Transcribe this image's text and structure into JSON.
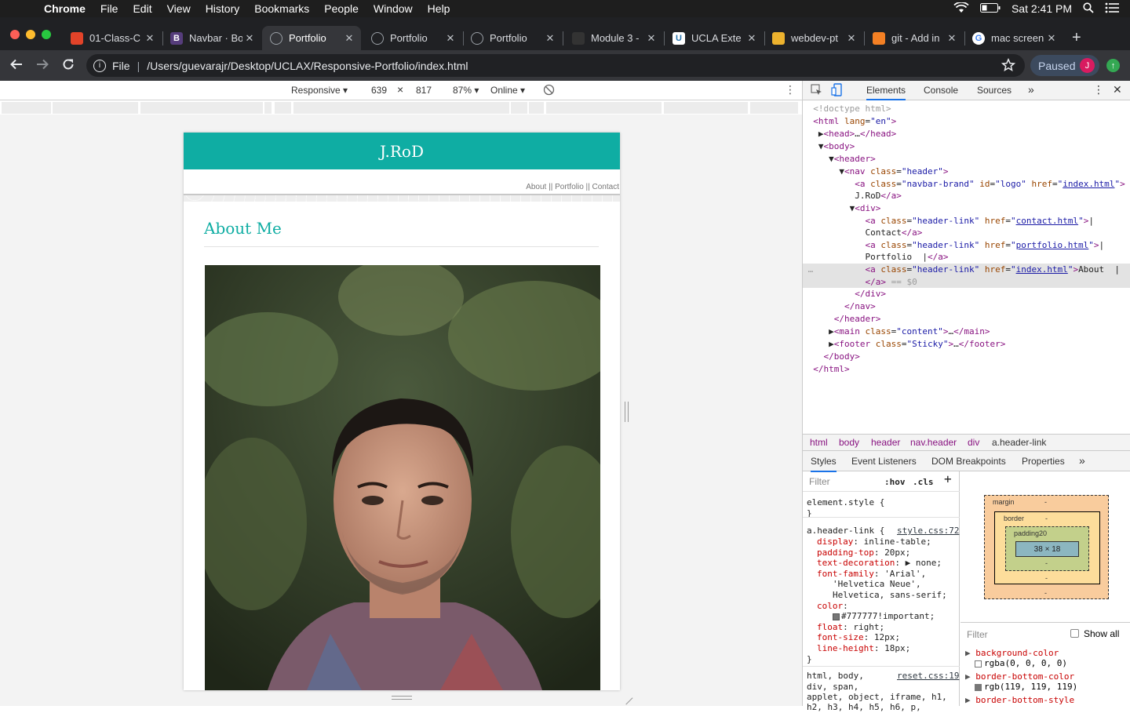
{
  "menubar": {
    "app": "Chrome",
    "items": [
      "File",
      "Edit",
      "View",
      "History",
      "Bookmarks",
      "People",
      "Window",
      "Help"
    ],
    "clock": "Sat 2:41 PM"
  },
  "tabs": [
    {
      "title": "01-Class-C",
      "icon": "gitlab-icon",
      "color": "#e24329"
    },
    {
      "title": "Navbar · Bo",
      "icon": "bootstrap-icon",
      "color": "#563d7c"
    },
    {
      "title": "Portfolio",
      "icon": "globe-icon",
      "color": "#5f6368"
    },
    {
      "title": "Portfolio",
      "icon": "globe-icon",
      "color": "#5f6368"
    },
    {
      "title": "Portfolio",
      "icon": "globe-icon",
      "color": "#5f6368"
    },
    {
      "title": "Module 3 -",
      "icon": "book-icon",
      "color": "#333333"
    },
    {
      "title": "UCLA Exte",
      "icon": "ucla-icon",
      "color": "#2774ae"
    },
    {
      "title": "webdev-pt",
      "icon": "slack-icon",
      "color": "#ecb22e"
    },
    {
      "title": "git - Add in",
      "icon": "stackoverflow-icon",
      "color": "#f48024"
    },
    {
      "title": "mac screen",
      "icon": "google-icon",
      "color": "#ffffff"
    }
  ],
  "active_tab": 2,
  "address": {
    "scheme": "File",
    "path": "/Users/guevarajr/Desktop/UCLAX/Responsive-Portfolio/index.html"
  },
  "profile": {
    "label": "Paused",
    "initial": "J"
  },
  "device": {
    "mode": "Responsive",
    "width": "639",
    "times": "×",
    "height": "817",
    "zoom": "87%",
    "network": "Online"
  },
  "site": {
    "brand": "J.RoD",
    "nav": "About || Portfolio || Contact",
    "heading": "About Me"
  },
  "devtools": {
    "tabs": [
      "Elements",
      "Console",
      "Sources"
    ],
    "breadcrumbs": [
      "html",
      "body",
      "header",
      "nav.header",
      "div",
      "a.header-link"
    ],
    "style_tabs": [
      "Styles",
      "Event Listeners",
      "DOM Breakpoints",
      "Properties"
    ],
    "filter_placeholder": "Filter",
    "hov": ":hov",
    "cls": ".cls",
    "element_style": "element.style {",
    "rule_selector": "a.header-link {",
    "rule_source": "style.css:72",
    "props": [
      {
        "name": "display",
        "value": "inline-table;"
      },
      {
        "name": "padding-top",
        "value": "20px;"
      },
      {
        "name": "text-decoration",
        "value": "▶ none;"
      },
      {
        "name": "font-family",
        "value": "'Arial',"
      },
      {
        "name": "",
        "value": "'Helvetica Neue',"
      },
      {
        "name": "",
        "value": "Helvetica, sans-serif;"
      },
      {
        "name": "color",
        "value": ""
      },
      {
        "name": "",
        "value": "#777777!important;"
      },
      {
        "name": "float",
        "value": "right;"
      },
      {
        "name": "font-size",
        "value": "12px;"
      },
      {
        "name": "line-height",
        "value": "18px;"
      }
    ],
    "reset_selector": "html, body,",
    "reset_source": "reset.css:19",
    "reset_lines": [
      "div, span,",
      "applet, object, iframe, h1,",
      "h2, h3, h4, h5, h6, p,"
    ],
    "box": {
      "margin": "margin",
      "border": "border",
      "padding": "padding20",
      "content": "38 × 18",
      "dash": "-"
    },
    "computed_filter": "Filter",
    "show_all": "Show all",
    "computed": [
      {
        "name": "background-color",
        "value": "rgba(0, 0, 0, 0)",
        "swatch": "#ffffff"
      },
      {
        "name": "border-bottom-color",
        "value": "rgb(119, 119, 119)",
        "swatch": "#777777"
      },
      {
        "name": "border-bottom-style",
        "value": "",
        "swatch": ""
      }
    ]
  }
}
